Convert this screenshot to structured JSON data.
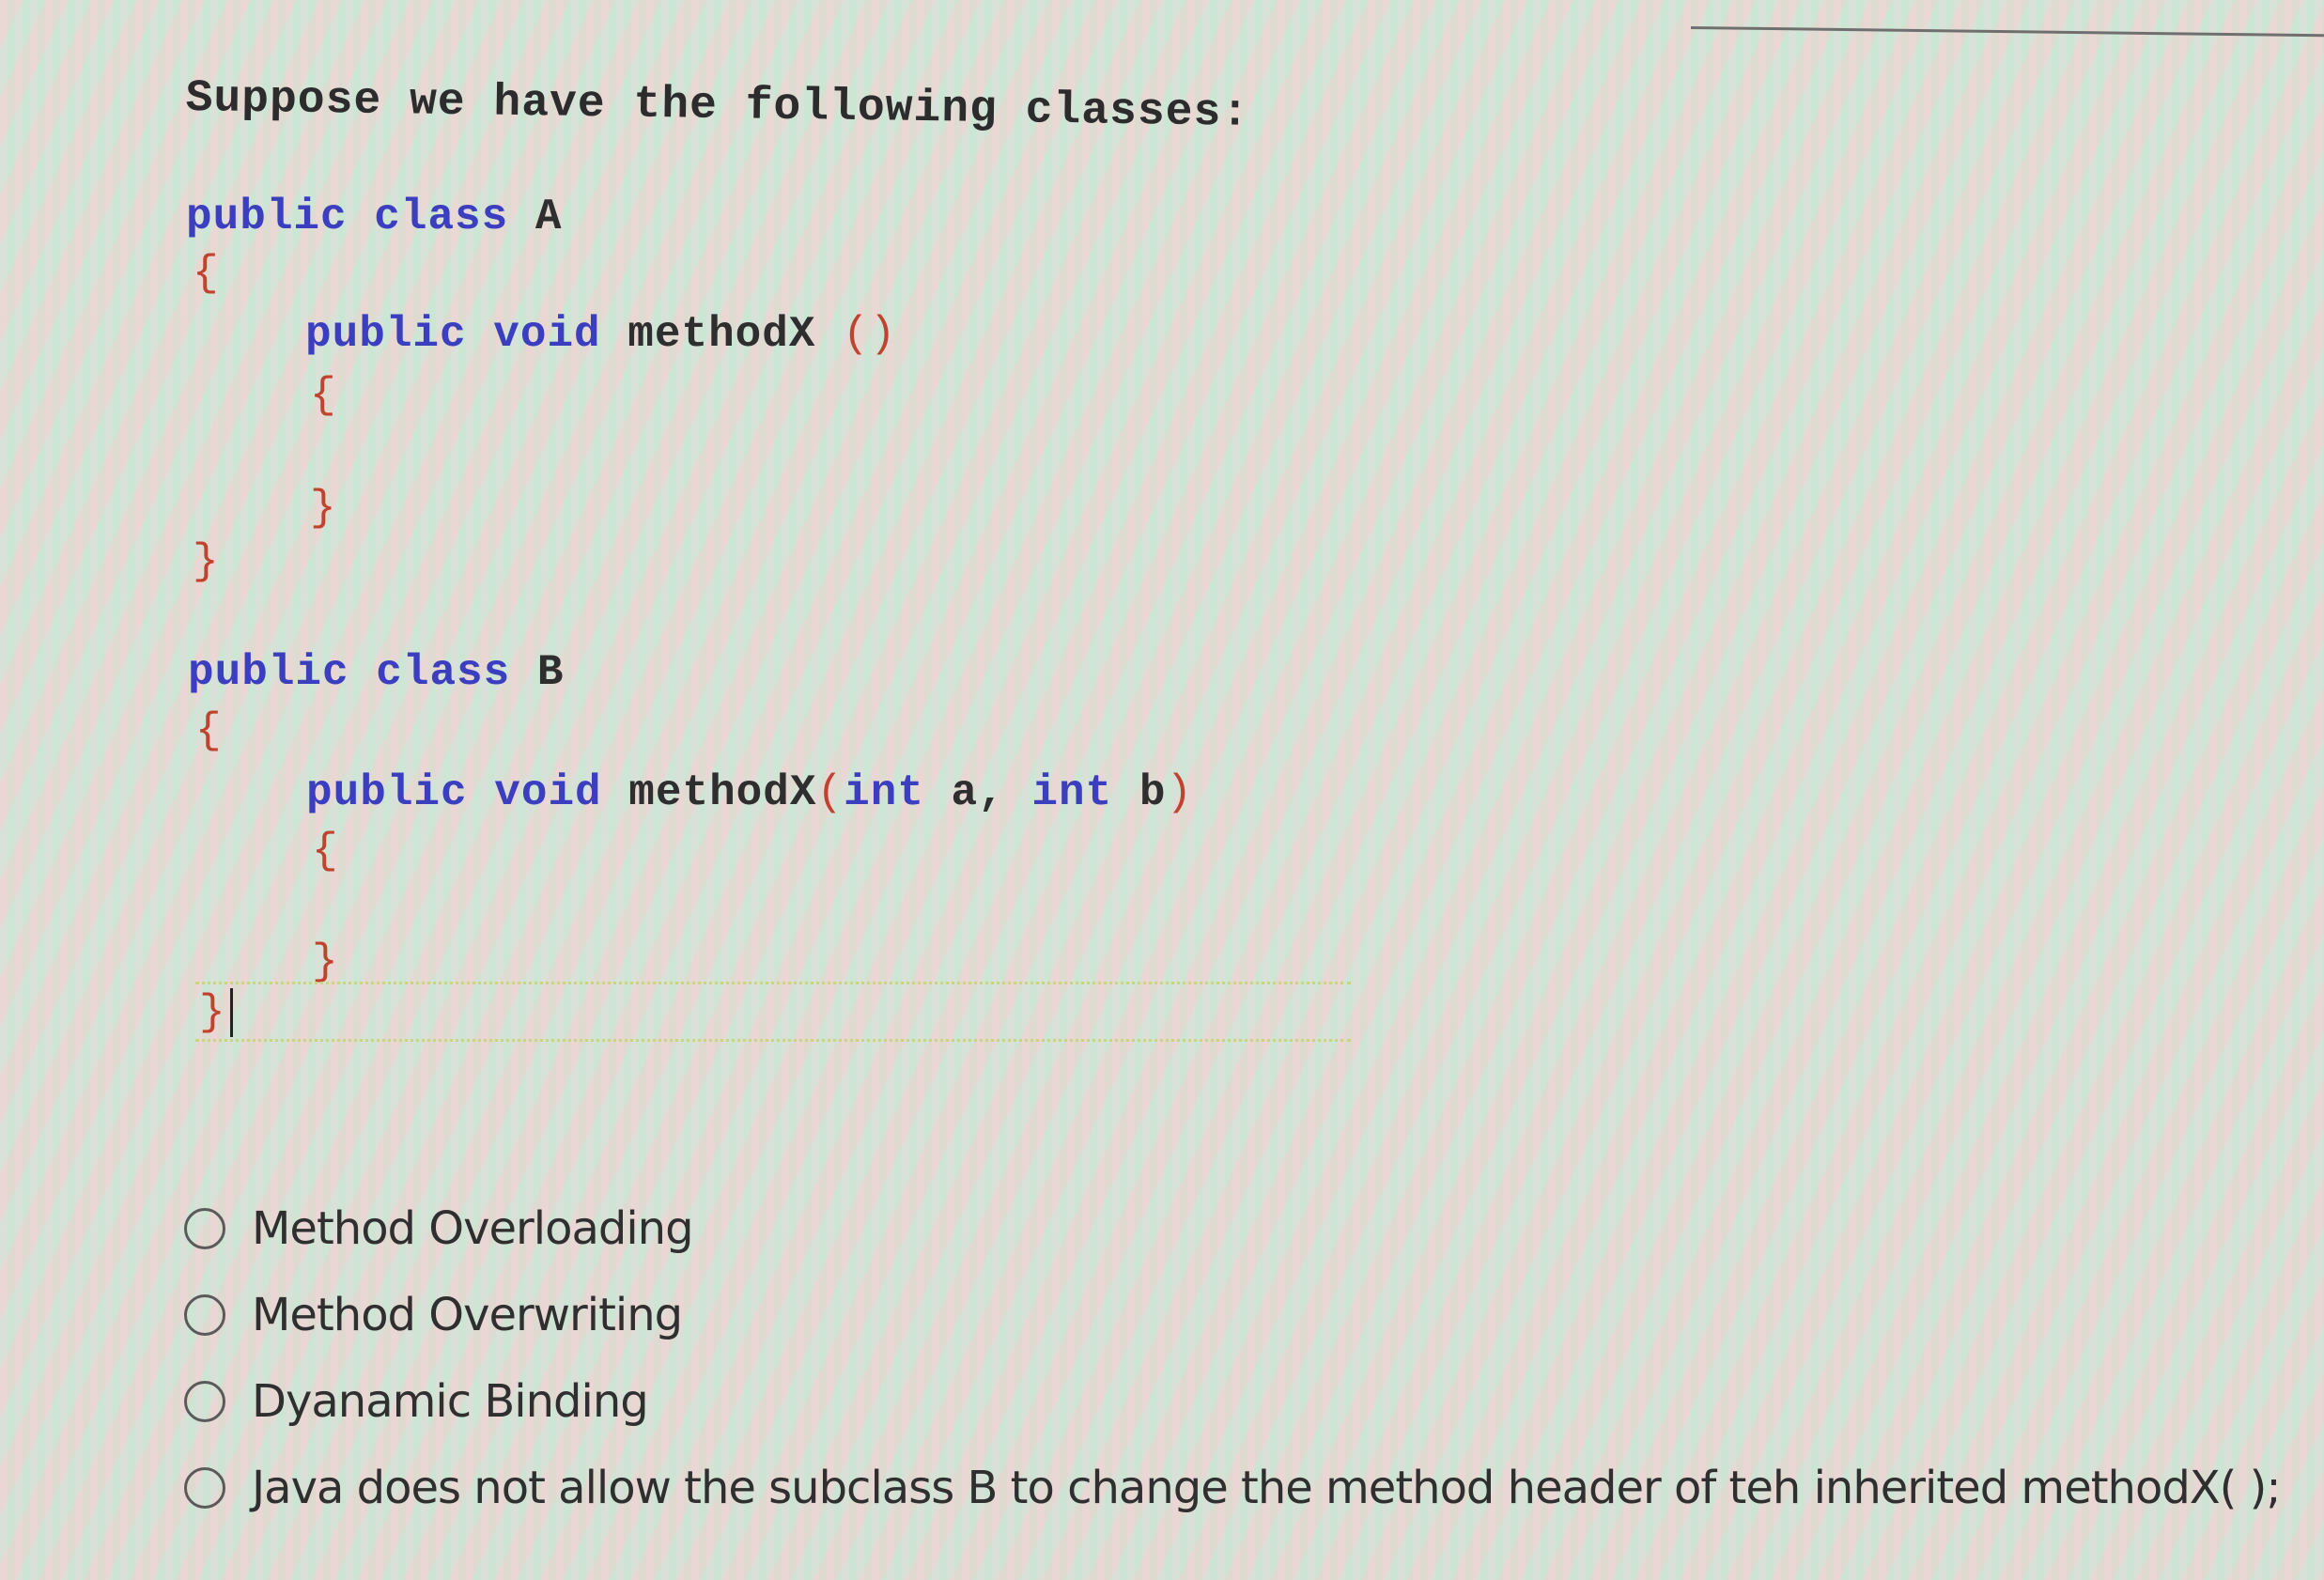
{
  "question": {
    "prompt": "Suppose we have the following classes:"
  },
  "code": {
    "class_a": {
      "header_kw": "public class",
      "name": "A",
      "open_brace": "{",
      "method_kw": "public void",
      "method_name": "methodX",
      "method_params_open": "(",
      "method_params_close": ")",
      "method_open_brace": "{",
      "method_close_brace": "}",
      "close_brace": "}"
    },
    "class_b": {
      "header_kw": "public class",
      "name": "B",
      "open_brace": "{",
      "method_kw": "public void",
      "method_name": "methodX",
      "method_params_open": "(",
      "param1_type": "int",
      "param1_name": "a,",
      "param2_type": "int",
      "param2_name": "b",
      "method_params_close": ")",
      "method_open_brace": "{",
      "method_close_brace": "}",
      "close_brace": "}"
    }
  },
  "options": [
    {
      "label": "Method Overloading",
      "selected": false
    },
    {
      "label": "Method Overwriting",
      "selected": false
    },
    {
      "label": "Dyanamic Binding",
      "selected": false
    },
    {
      "label": "Java does not allow the subclass B to change the method header of teh inherited methodX( );",
      "selected": false
    }
  ],
  "colors": {
    "keyword": "#3b3fbf",
    "identifier": "#2e2e2e",
    "brace": "#c0432f"
  }
}
